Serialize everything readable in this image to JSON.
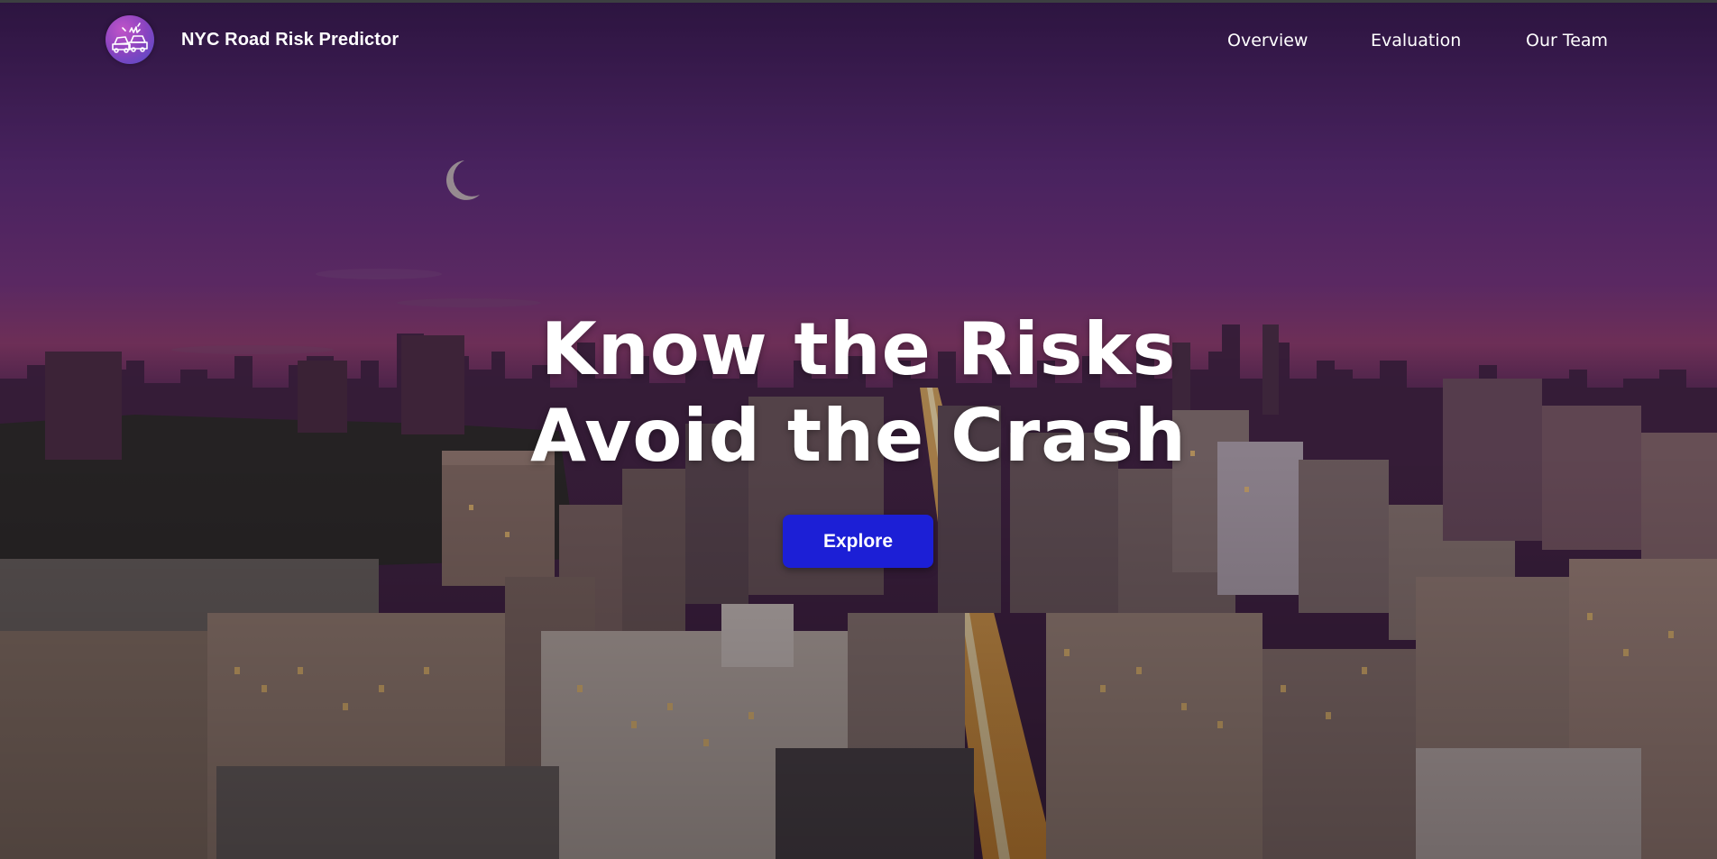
{
  "header": {
    "brand": "NYC Road Risk Predictor",
    "logo_icon": "car-crash-icon",
    "nav": [
      {
        "label": "Overview"
      },
      {
        "label": "Evaluation"
      },
      {
        "label": "Our Team"
      }
    ]
  },
  "hero": {
    "background": "nyc-skyline-dusk-photo",
    "headline_line1": "Know the Risks",
    "headline_line2": "Avoid the Crash",
    "cta_label": "Explore"
  },
  "colors": {
    "button": "#1c1fd6",
    "text": "#ffffff",
    "sky_top": "#3a1850",
    "sky_glow": "#8a3a70"
  }
}
